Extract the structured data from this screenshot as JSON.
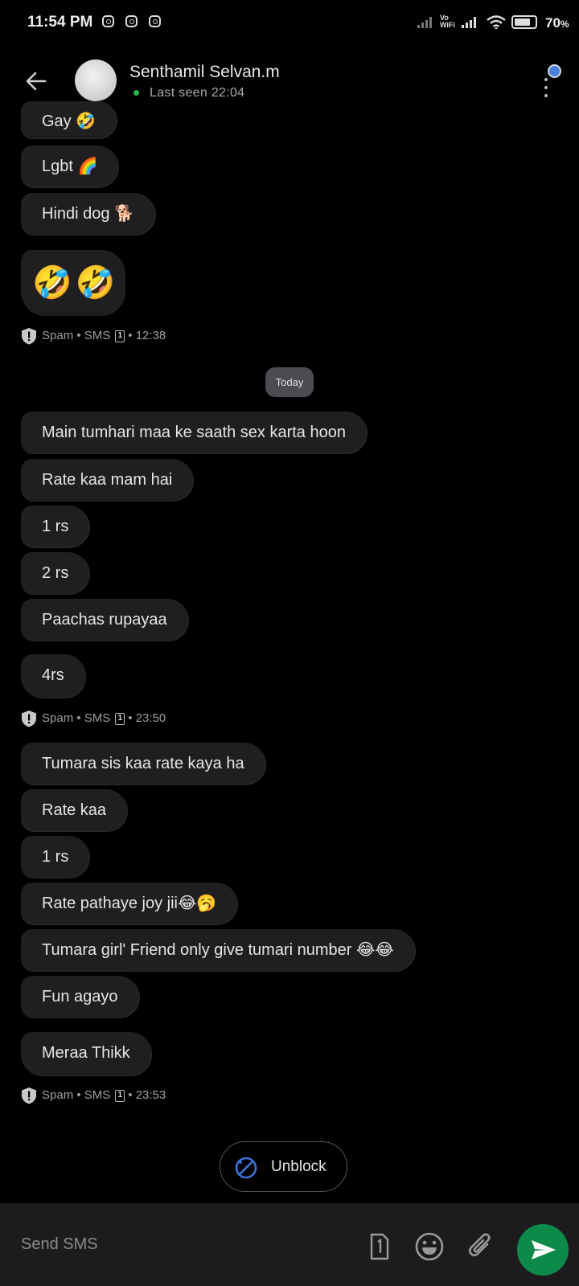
{
  "status_bar": {
    "time": "11:54 PM",
    "battery": "70",
    "battery_symbol": "%",
    "vowifi": "Vo WiFi"
  },
  "header": {
    "contact_name": "Senthamil Selvan.m",
    "last_seen": "Last seen 22:04"
  },
  "messages_group1": [
    {
      "text": "Gay 🤣"
    },
    {
      "text": "Lgbt 🌈"
    },
    {
      "text": "Hindi dog 🐕"
    }
  ],
  "emoji_message": "🤣🤣",
  "meta1": {
    "label": "Spam • SMS",
    "sim": "1",
    "time": "• 12:38"
  },
  "date_chip": "Today",
  "messages_group2": [
    {
      "text": "Main tumhari maa ke saath sex karta hoon"
    },
    {
      "text": "Rate kaa mam hai"
    },
    {
      "text": "1 rs"
    },
    {
      "text": "2 rs"
    },
    {
      "text": "Paachas rupayaa"
    },
    {
      "text": "4rs"
    }
  ],
  "meta2": {
    "label": "Spam • SMS",
    "sim": "1",
    "time": "• 23:50"
  },
  "messages_group3": [
    {
      "text": "Tumara sis kaa rate kaya ha"
    },
    {
      "text": "Rate kaa"
    },
    {
      "text": "1 rs"
    },
    {
      "text": "Rate pathaye joy jii😂🥱"
    },
    {
      "text": "Tumara girl' Friend only give tumari number 😂😂"
    },
    {
      "text": "Fun agayo"
    },
    {
      "text": "Meraa Thikk"
    }
  ],
  "meta3": {
    "label": "Spam • SMS",
    "sim": "1",
    "time": "• 23:53"
  },
  "unblock_button": {
    "label": "Unblock"
  },
  "compose": {
    "placeholder": "Send SMS"
  },
  "colors": {
    "background": "#000000",
    "bubble": "#1f1f21",
    "send_button": "#0d8a4a",
    "unblock_icon": "#3d73d9"
  },
  "icons": [
    "back-arrow-icon",
    "instagram-icon",
    "signal-icon",
    "wifi-icon",
    "battery-icon",
    "more-vert-icon",
    "shield-icon",
    "sim-icon",
    "unblock-icon",
    "sim-select-icon",
    "emoji-icon",
    "attach-icon",
    "send-icon"
  ]
}
